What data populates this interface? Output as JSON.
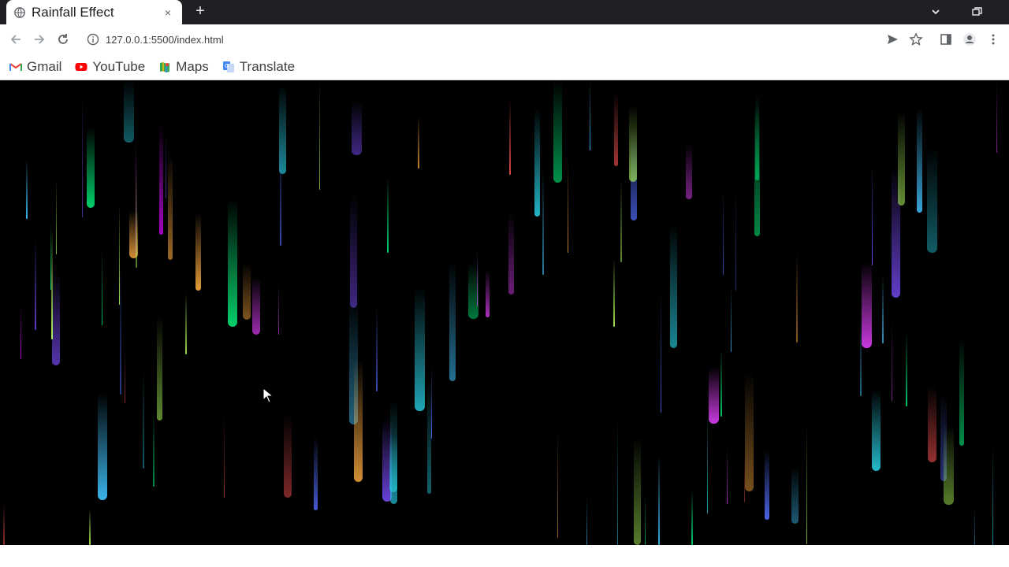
{
  "tab": {
    "title": "Rainfall Effect",
    "close_label": "×"
  },
  "new_tab_label": "+",
  "toolbar": {
    "url": "127.0.0.1:5500/index.html"
  },
  "bookmarks": [
    {
      "label": "Gmail",
      "icon": "gmail-icon"
    },
    {
      "label": "YouTube",
      "icon": "youtube-icon"
    },
    {
      "label": "Maps",
      "icon": "maps-icon"
    },
    {
      "label": "Translate",
      "icon": "translate-icon"
    }
  ],
  "colors": {
    "tabstrip": "#202124",
    "page_background": "#000000",
    "drop_palette": [
      "#e040fb",
      "#7c4dff",
      "#40c4ff",
      "#00e676",
      "#b2ff59",
      "#ffab40",
      "#ff5252",
      "#26c6da",
      "#d500f9",
      "#536dfe"
    ]
  },
  "page": {
    "effect": "rainfall",
    "drop_count": 110
  }
}
